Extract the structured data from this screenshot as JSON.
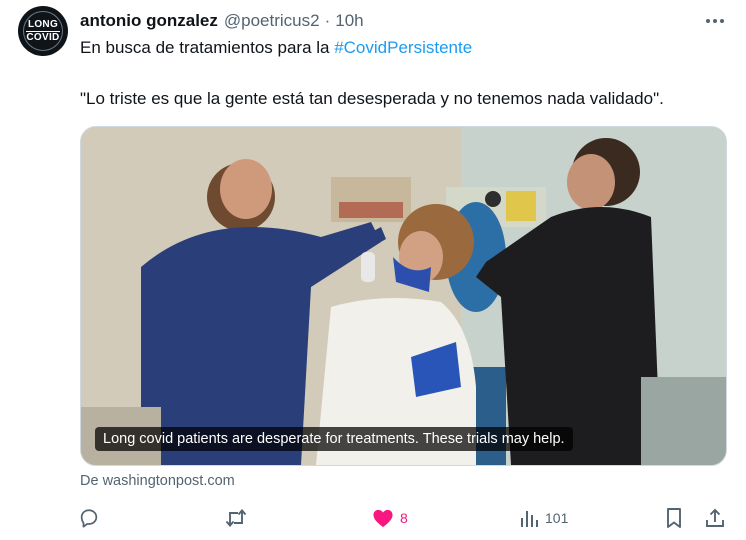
{
  "tweet": {
    "author_name": "antonio gonzalez",
    "author_handle": "@poetricus2",
    "separator": "·",
    "timestamp": "10h",
    "avatar_text": [
      "LONG",
      "COVID"
    ],
    "text_prefix": "En busca de tratamientos para la ",
    "hashtag": "#CovidPersistente",
    "quote": "\"Lo triste es que la gente está tan desesperada y no tenemos nada validado\".",
    "card": {
      "caption": "Long covid patients are desperate for treatments. These trials may help.",
      "source": "De washingtonpost.com"
    },
    "actions": {
      "likes": "8",
      "views": "101"
    }
  },
  "colors": {
    "accent": "#1d9bf0",
    "like": "#f91880",
    "muted": "#536471"
  },
  "icons": [
    "more-icon",
    "reply-icon",
    "retweet-icon",
    "heart-icon",
    "views-icon",
    "bookmark-icon",
    "share-icon"
  ]
}
